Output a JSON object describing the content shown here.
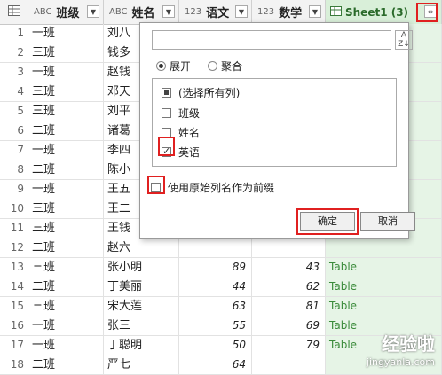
{
  "columns": [
    {
      "type_icon": "ABC",
      "name": "班级"
    },
    {
      "type_icon": "ABC",
      "name": "姓名"
    },
    {
      "type_icon": "123",
      "name": "语文"
    },
    {
      "type_icon": "123",
      "name": "数学"
    },
    {
      "type_icon": "table-icon",
      "name": "Sheet1 (3)"
    }
  ],
  "rows": [
    {
      "n": "1",
      "cls": "一班",
      "name": "刘八",
      "yw": "",
      "sx": "",
      "t": ""
    },
    {
      "n": "2",
      "cls": "三班",
      "name": "钱多",
      "yw": "",
      "sx": "",
      "t": ""
    },
    {
      "n": "3",
      "cls": "一班",
      "name": "赵钱",
      "yw": "",
      "sx": "",
      "t": ""
    },
    {
      "n": "4",
      "cls": "三班",
      "name": "邓天",
      "yw": "",
      "sx": "",
      "t": ""
    },
    {
      "n": "5",
      "cls": "三班",
      "name": "刘平",
      "yw": "",
      "sx": "",
      "t": ""
    },
    {
      "n": "6",
      "cls": "二班",
      "name": "诸葛",
      "yw": "",
      "sx": "",
      "t": ""
    },
    {
      "n": "7",
      "cls": "一班",
      "name": "李四",
      "yw": "",
      "sx": "",
      "t": ""
    },
    {
      "n": "8",
      "cls": "二班",
      "name": "陈小",
      "yw": "",
      "sx": "",
      "t": ""
    },
    {
      "n": "9",
      "cls": "一班",
      "name": "王五",
      "yw": "",
      "sx": "",
      "t": ""
    },
    {
      "n": "10",
      "cls": "三班",
      "name": "王二",
      "yw": "",
      "sx": "",
      "t": ""
    },
    {
      "n": "11",
      "cls": "三班",
      "name": "王钱",
      "yw": "",
      "sx": "",
      "t": ""
    },
    {
      "n": "12",
      "cls": "二班",
      "name": "赵六",
      "yw": "",
      "sx": "",
      "t": ""
    },
    {
      "n": "13",
      "cls": "三班",
      "name": "张小明",
      "yw": "89",
      "sx": "43",
      "t": "Table"
    },
    {
      "n": "14",
      "cls": "二班",
      "name": "丁美丽",
      "yw": "44",
      "sx": "62",
      "t": "Table"
    },
    {
      "n": "15",
      "cls": "三班",
      "name": "宋大莲",
      "yw": "63",
      "sx": "81",
      "t": "Table"
    },
    {
      "n": "16",
      "cls": "一班",
      "name": "张三",
      "yw": "55",
      "sx": "69",
      "t": "Table"
    },
    {
      "n": "17",
      "cls": "一班",
      "name": "丁聪明",
      "yw": "50",
      "sx": "79",
      "t": "Table"
    },
    {
      "n": "18",
      "cls": "二班",
      "name": "严七",
      "yw": "64",
      "sx": "",
      "t": ""
    }
  ],
  "popup": {
    "search_placeholder": "",
    "expand_label": "展开",
    "aggregate_label": "聚合",
    "items": [
      "(选择所有列)",
      "班级",
      "姓名",
      "英语"
    ],
    "prefix_label": "使用原始列名作为前缀",
    "ok_label": "确定",
    "cancel_label": "取消"
  },
  "watermark": {
    "main": "经验啦",
    "sub": "jingyanla.com"
  }
}
